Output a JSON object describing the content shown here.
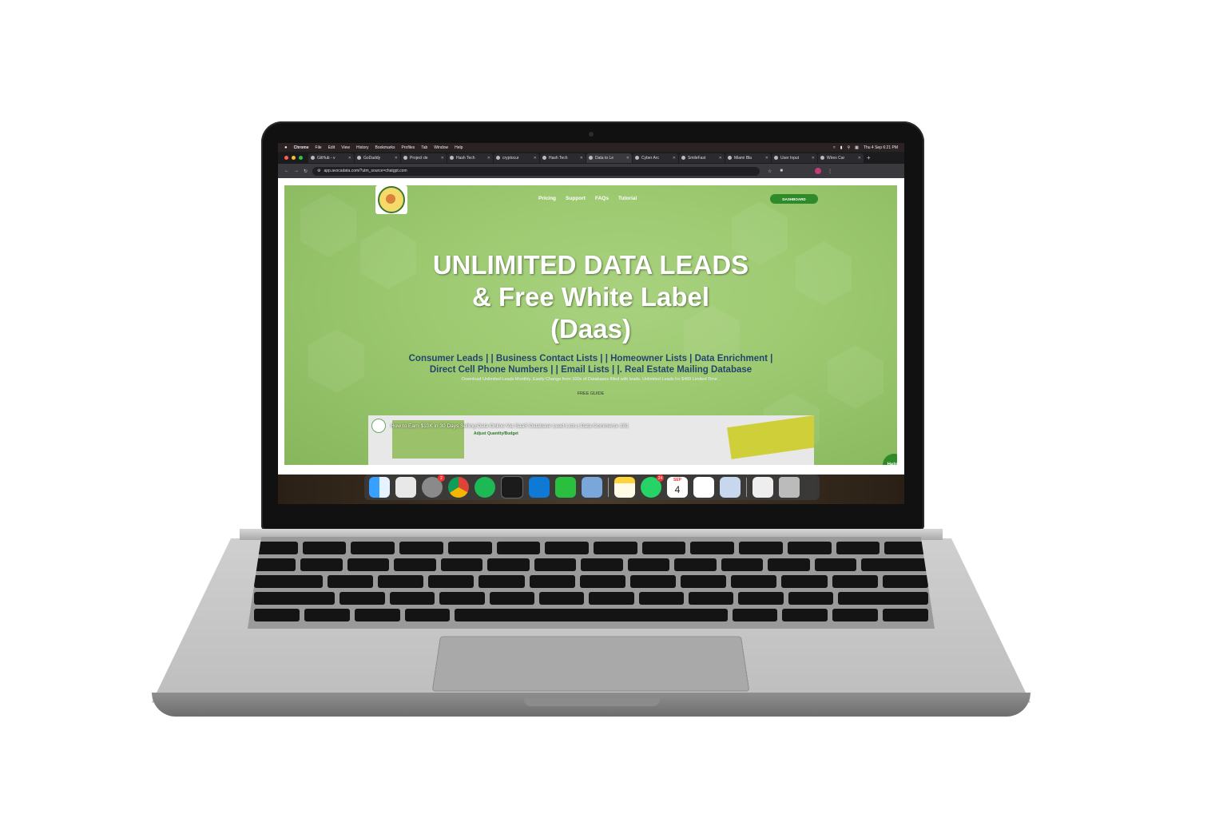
{
  "menubar": {
    "apple_icon": "apple-logo-icon",
    "items": [
      "Chrome",
      "File",
      "Edit",
      "View",
      "History",
      "Bookmarks",
      "Profiles",
      "Tab",
      "Window",
      "Help"
    ],
    "clock": "Thu 4 Sep  6:21 PM"
  },
  "tabs": [
    {
      "label": "GitHub - v"
    },
    {
      "label": "GoDaddy"
    },
    {
      "label": "Project de"
    },
    {
      "label": "Hash Tech"
    },
    {
      "label": "cryptocur"
    },
    {
      "label": "Hash Tech"
    },
    {
      "label": "Data to Le",
      "active": true
    },
    {
      "label": "Cyber Arc"
    },
    {
      "label": "SmileFast"
    },
    {
      "label": "Miami Bla"
    },
    {
      "label": "User Input"
    },
    {
      "label": "Wirex Car"
    }
  ],
  "toolbar": {
    "url": "app.avocadata.com/?utm_source=chatgpt.com"
  },
  "site": {
    "nav": [
      "Pricing",
      "Support",
      "FAQs",
      "Tutorial"
    ],
    "dashboard_label": "DASHBOARD",
    "headline_lines": [
      "UNLIMITED DATA LEADS",
      "& Free White Label",
      "(Daas)"
    ],
    "subcategories_line1": "Consumer Leads | | Business Contact Lists | | Homeowner Lists | Data Enrichment |",
    "subcategories_line2": "Direct Cell Phone Numbers | | Email Lists | |. Real Estate Mailing Database",
    "tagline": "Download Unlimited Leads Monthly. Easily Change from 100s of Databases filled with leads. Unlimited Leads for $499 Limited Time .",
    "free_guide": "FREE GUIDE",
    "video_title": "How to Earn $10K in 30 Days Selling Data Online Via SaaS Database Lead Lists | Data Commerce 101",
    "video_sublabel": "Adjust Quantity/Budget",
    "help_label": "Help?"
  },
  "dock": {
    "finder_icon": "finder-icon",
    "launchpad_icon": "launchpad-icon",
    "settings_badge": "2",
    "chrome_icon": "chrome-icon",
    "spotify_icon": "spotify-icon",
    "terminal_icon": "terminal-icon",
    "vscode_icon": "vscode-icon",
    "messages_icon": "messages-icon",
    "simulator_icon": "simulator-icon",
    "notes_icon": "notes-icon",
    "whatsapp_badge": "24",
    "calendar_month": "SEP",
    "calendar_day": "4",
    "trash_icon": "trash-icon"
  },
  "colors": {
    "hero_green": "#9cc970",
    "brand_green": "#2f8a2a",
    "subcategory_blue": "#24466b"
  }
}
